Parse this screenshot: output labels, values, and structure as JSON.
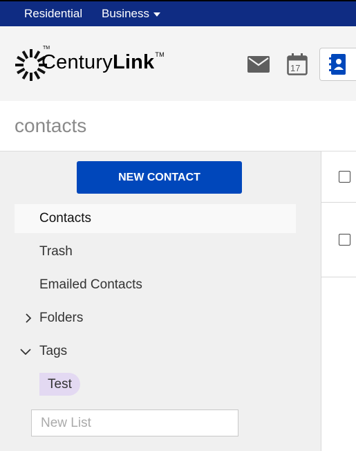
{
  "topnav": {
    "residential": "Residential",
    "business": "Business"
  },
  "brand": {
    "logo_text_regular": "Century",
    "logo_text_bold": "Link",
    "tm": "TM",
    "logo_mark_tm": "TM"
  },
  "apps": {
    "mail_icon": "mail-icon",
    "calendar_icon": "calendar-icon",
    "calendar_day": "17",
    "contacts_icon": "contacts-icon",
    "active": "contacts"
  },
  "page": {
    "title": "contacts"
  },
  "sidebar": {
    "new_contact_label": "NEW CONTACT",
    "items": [
      {
        "label": "Contacts",
        "active": true
      },
      {
        "label": "Trash"
      },
      {
        "label": "Emailed Contacts"
      },
      {
        "label": "Folders",
        "expandable": true,
        "expanded": false
      },
      {
        "label": "Tags",
        "expandable": true,
        "expanded": true
      }
    ],
    "tags": [
      {
        "label": "Test",
        "color": "#e3d9f2"
      }
    ],
    "new_list_placeholder": "New List"
  },
  "colors": {
    "topbar": "#0f2c83",
    "accent": "#0047bb"
  }
}
